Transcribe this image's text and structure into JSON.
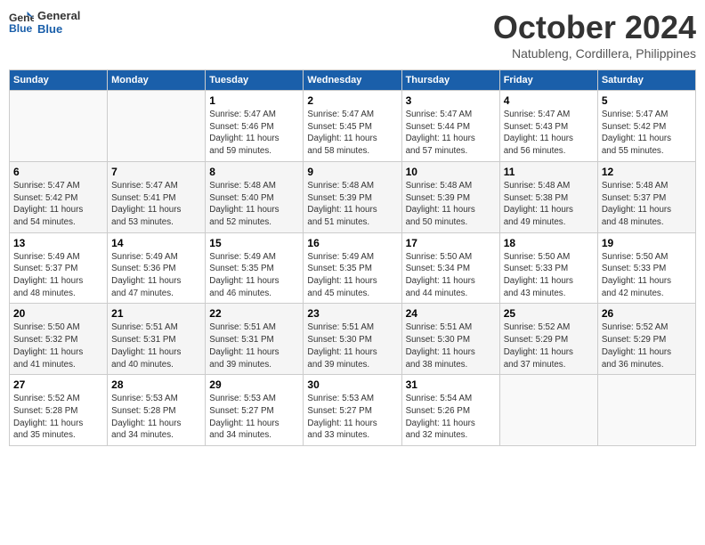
{
  "header": {
    "logo_line1": "General",
    "logo_line2": "Blue",
    "month": "October 2024",
    "location": "Natubleng, Cordillera, Philippines"
  },
  "days_of_week": [
    "Sunday",
    "Monday",
    "Tuesday",
    "Wednesday",
    "Thursday",
    "Friday",
    "Saturday"
  ],
  "weeks": [
    [
      {
        "day": "",
        "info": ""
      },
      {
        "day": "",
        "info": ""
      },
      {
        "day": "1",
        "info": "Sunrise: 5:47 AM\nSunset: 5:46 PM\nDaylight: 11 hours\nand 59 minutes."
      },
      {
        "day": "2",
        "info": "Sunrise: 5:47 AM\nSunset: 5:45 PM\nDaylight: 11 hours\nand 58 minutes."
      },
      {
        "day": "3",
        "info": "Sunrise: 5:47 AM\nSunset: 5:44 PM\nDaylight: 11 hours\nand 57 minutes."
      },
      {
        "day": "4",
        "info": "Sunrise: 5:47 AM\nSunset: 5:43 PM\nDaylight: 11 hours\nand 56 minutes."
      },
      {
        "day": "5",
        "info": "Sunrise: 5:47 AM\nSunset: 5:42 PM\nDaylight: 11 hours\nand 55 minutes."
      }
    ],
    [
      {
        "day": "6",
        "info": "Sunrise: 5:47 AM\nSunset: 5:42 PM\nDaylight: 11 hours\nand 54 minutes."
      },
      {
        "day": "7",
        "info": "Sunrise: 5:47 AM\nSunset: 5:41 PM\nDaylight: 11 hours\nand 53 minutes."
      },
      {
        "day": "8",
        "info": "Sunrise: 5:48 AM\nSunset: 5:40 PM\nDaylight: 11 hours\nand 52 minutes."
      },
      {
        "day": "9",
        "info": "Sunrise: 5:48 AM\nSunset: 5:39 PM\nDaylight: 11 hours\nand 51 minutes."
      },
      {
        "day": "10",
        "info": "Sunrise: 5:48 AM\nSunset: 5:39 PM\nDaylight: 11 hours\nand 50 minutes."
      },
      {
        "day": "11",
        "info": "Sunrise: 5:48 AM\nSunset: 5:38 PM\nDaylight: 11 hours\nand 49 minutes."
      },
      {
        "day": "12",
        "info": "Sunrise: 5:48 AM\nSunset: 5:37 PM\nDaylight: 11 hours\nand 48 minutes."
      }
    ],
    [
      {
        "day": "13",
        "info": "Sunrise: 5:49 AM\nSunset: 5:37 PM\nDaylight: 11 hours\nand 48 minutes."
      },
      {
        "day": "14",
        "info": "Sunrise: 5:49 AM\nSunset: 5:36 PM\nDaylight: 11 hours\nand 47 minutes."
      },
      {
        "day": "15",
        "info": "Sunrise: 5:49 AM\nSunset: 5:35 PM\nDaylight: 11 hours\nand 46 minutes."
      },
      {
        "day": "16",
        "info": "Sunrise: 5:49 AM\nSunset: 5:35 PM\nDaylight: 11 hours\nand 45 minutes."
      },
      {
        "day": "17",
        "info": "Sunrise: 5:50 AM\nSunset: 5:34 PM\nDaylight: 11 hours\nand 44 minutes."
      },
      {
        "day": "18",
        "info": "Sunrise: 5:50 AM\nSunset: 5:33 PM\nDaylight: 11 hours\nand 43 minutes."
      },
      {
        "day": "19",
        "info": "Sunrise: 5:50 AM\nSunset: 5:33 PM\nDaylight: 11 hours\nand 42 minutes."
      }
    ],
    [
      {
        "day": "20",
        "info": "Sunrise: 5:50 AM\nSunset: 5:32 PM\nDaylight: 11 hours\nand 41 minutes."
      },
      {
        "day": "21",
        "info": "Sunrise: 5:51 AM\nSunset: 5:31 PM\nDaylight: 11 hours\nand 40 minutes."
      },
      {
        "day": "22",
        "info": "Sunrise: 5:51 AM\nSunset: 5:31 PM\nDaylight: 11 hours\nand 39 minutes."
      },
      {
        "day": "23",
        "info": "Sunrise: 5:51 AM\nSunset: 5:30 PM\nDaylight: 11 hours\nand 39 minutes."
      },
      {
        "day": "24",
        "info": "Sunrise: 5:51 AM\nSunset: 5:30 PM\nDaylight: 11 hours\nand 38 minutes."
      },
      {
        "day": "25",
        "info": "Sunrise: 5:52 AM\nSunset: 5:29 PM\nDaylight: 11 hours\nand 37 minutes."
      },
      {
        "day": "26",
        "info": "Sunrise: 5:52 AM\nSunset: 5:29 PM\nDaylight: 11 hours\nand 36 minutes."
      }
    ],
    [
      {
        "day": "27",
        "info": "Sunrise: 5:52 AM\nSunset: 5:28 PM\nDaylight: 11 hours\nand 35 minutes."
      },
      {
        "day": "28",
        "info": "Sunrise: 5:53 AM\nSunset: 5:28 PM\nDaylight: 11 hours\nand 34 minutes."
      },
      {
        "day": "29",
        "info": "Sunrise: 5:53 AM\nSunset: 5:27 PM\nDaylight: 11 hours\nand 34 minutes."
      },
      {
        "day": "30",
        "info": "Sunrise: 5:53 AM\nSunset: 5:27 PM\nDaylight: 11 hours\nand 33 minutes."
      },
      {
        "day": "31",
        "info": "Sunrise: 5:54 AM\nSunset: 5:26 PM\nDaylight: 11 hours\nand 32 minutes."
      },
      {
        "day": "",
        "info": ""
      },
      {
        "day": "",
        "info": ""
      }
    ]
  ]
}
